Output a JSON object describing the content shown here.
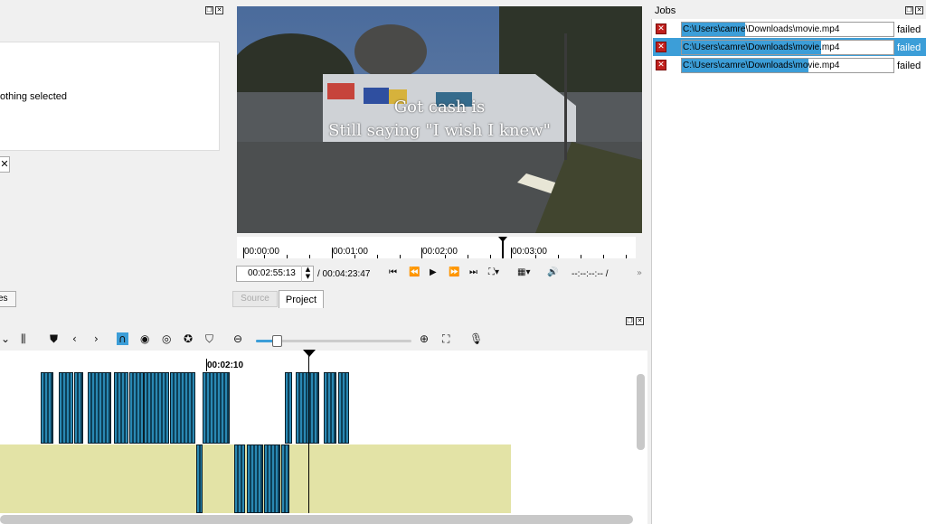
{
  "properties": {
    "message": "othing selected"
  },
  "left_tab": {
    "label": "es"
  },
  "video": {
    "subtitle_line1": "Got cash is",
    "subtitle_line2": "Still saying \"I wish I knew\""
  },
  "ruler": {
    "ticks": [
      "00:00:00",
      "00:01:00",
      "00:02:00",
      "00:03:00"
    ]
  },
  "transport": {
    "position": "00:02:55:13",
    "duration": "/ 00:04:23:47",
    "in_out": "--:--:--:-- /"
  },
  "tabs": {
    "source": "Source",
    "project": "Project"
  },
  "timeline": {
    "time_marker": "00:02:10",
    "zoom": 0.12
  },
  "jobs": {
    "title": "Jobs",
    "items": [
      {
        "path": "C:\\Users\\camre\\Downloads\\movie.mp4",
        "status": "failed",
        "progress": 0.3,
        "selected": false
      },
      {
        "path": "C:\\Users\\camre\\Downloads\\movie.mp4",
        "status": "failed",
        "progress": 0.66,
        "selected": true
      },
      {
        "path": "C:\\Users\\camre\\Downloads\\movie.mp4",
        "status": "failed",
        "progress": 0.6,
        "selected": false
      }
    ]
  },
  "colors": {
    "selection": "#3c9ed8",
    "audio_track": "#e3e3a6",
    "clip": "#2a88b3",
    "error": "#c0201d"
  }
}
